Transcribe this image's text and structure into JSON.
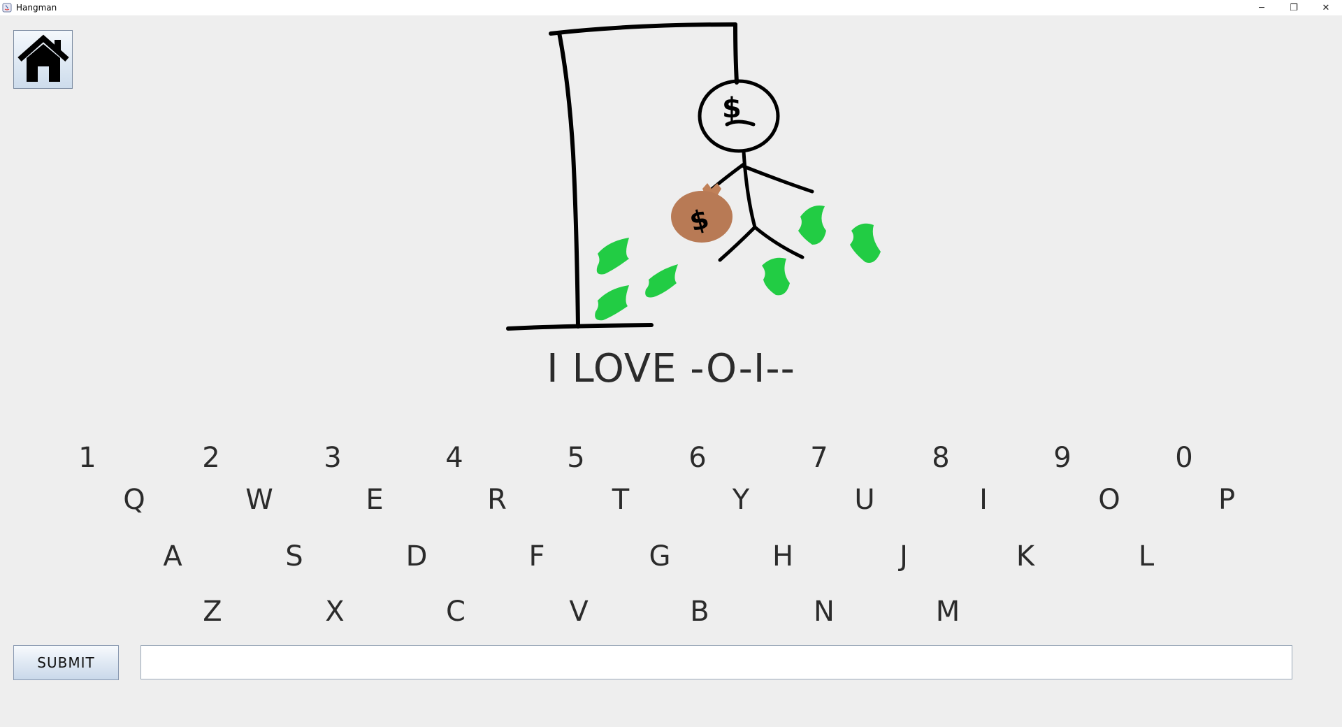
{
  "window": {
    "title": "Hangman",
    "controls": {
      "minimize": "─",
      "restore": "❐",
      "close": "✕"
    }
  },
  "home_button": {
    "icon": "house-icon"
  },
  "drawing": {
    "icons": [
      "gallows",
      "stick-figure",
      "money-bag-icon",
      "dollar-bill-icon"
    ],
    "colors": {
      "bill": "#22cc44",
      "bag": "#b87a55",
      "ink": "#000000"
    }
  },
  "phrase": "I LOVE -O-I--",
  "keyboard": {
    "numbers": [
      "1",
      "2",
      "3",
      "4",
      "5",
      "6",
      "7",
      "8",
      "9",
      "0"
    ],
    "row1": [
      "Q",
      "W",
      "E",
      "R",
      "T",
      "Y",
      "U",
      "I",
      "O",
      "P"
    ],
    "row2": [
      "A",
      "S",
      "D",
      "F",
      "G",
      "H",
      "J",
      "K",
      "L"
    ],
    "row3": [
      "Z",
      "X",
      "C",
      "V",
      "B",
      "N",
      "M"
    ]
  },
  "submit": {
    "label": "SUBMIT"
  },
  "guess_input": {
    "value": "",
    "placeholder": ""
  }
}
